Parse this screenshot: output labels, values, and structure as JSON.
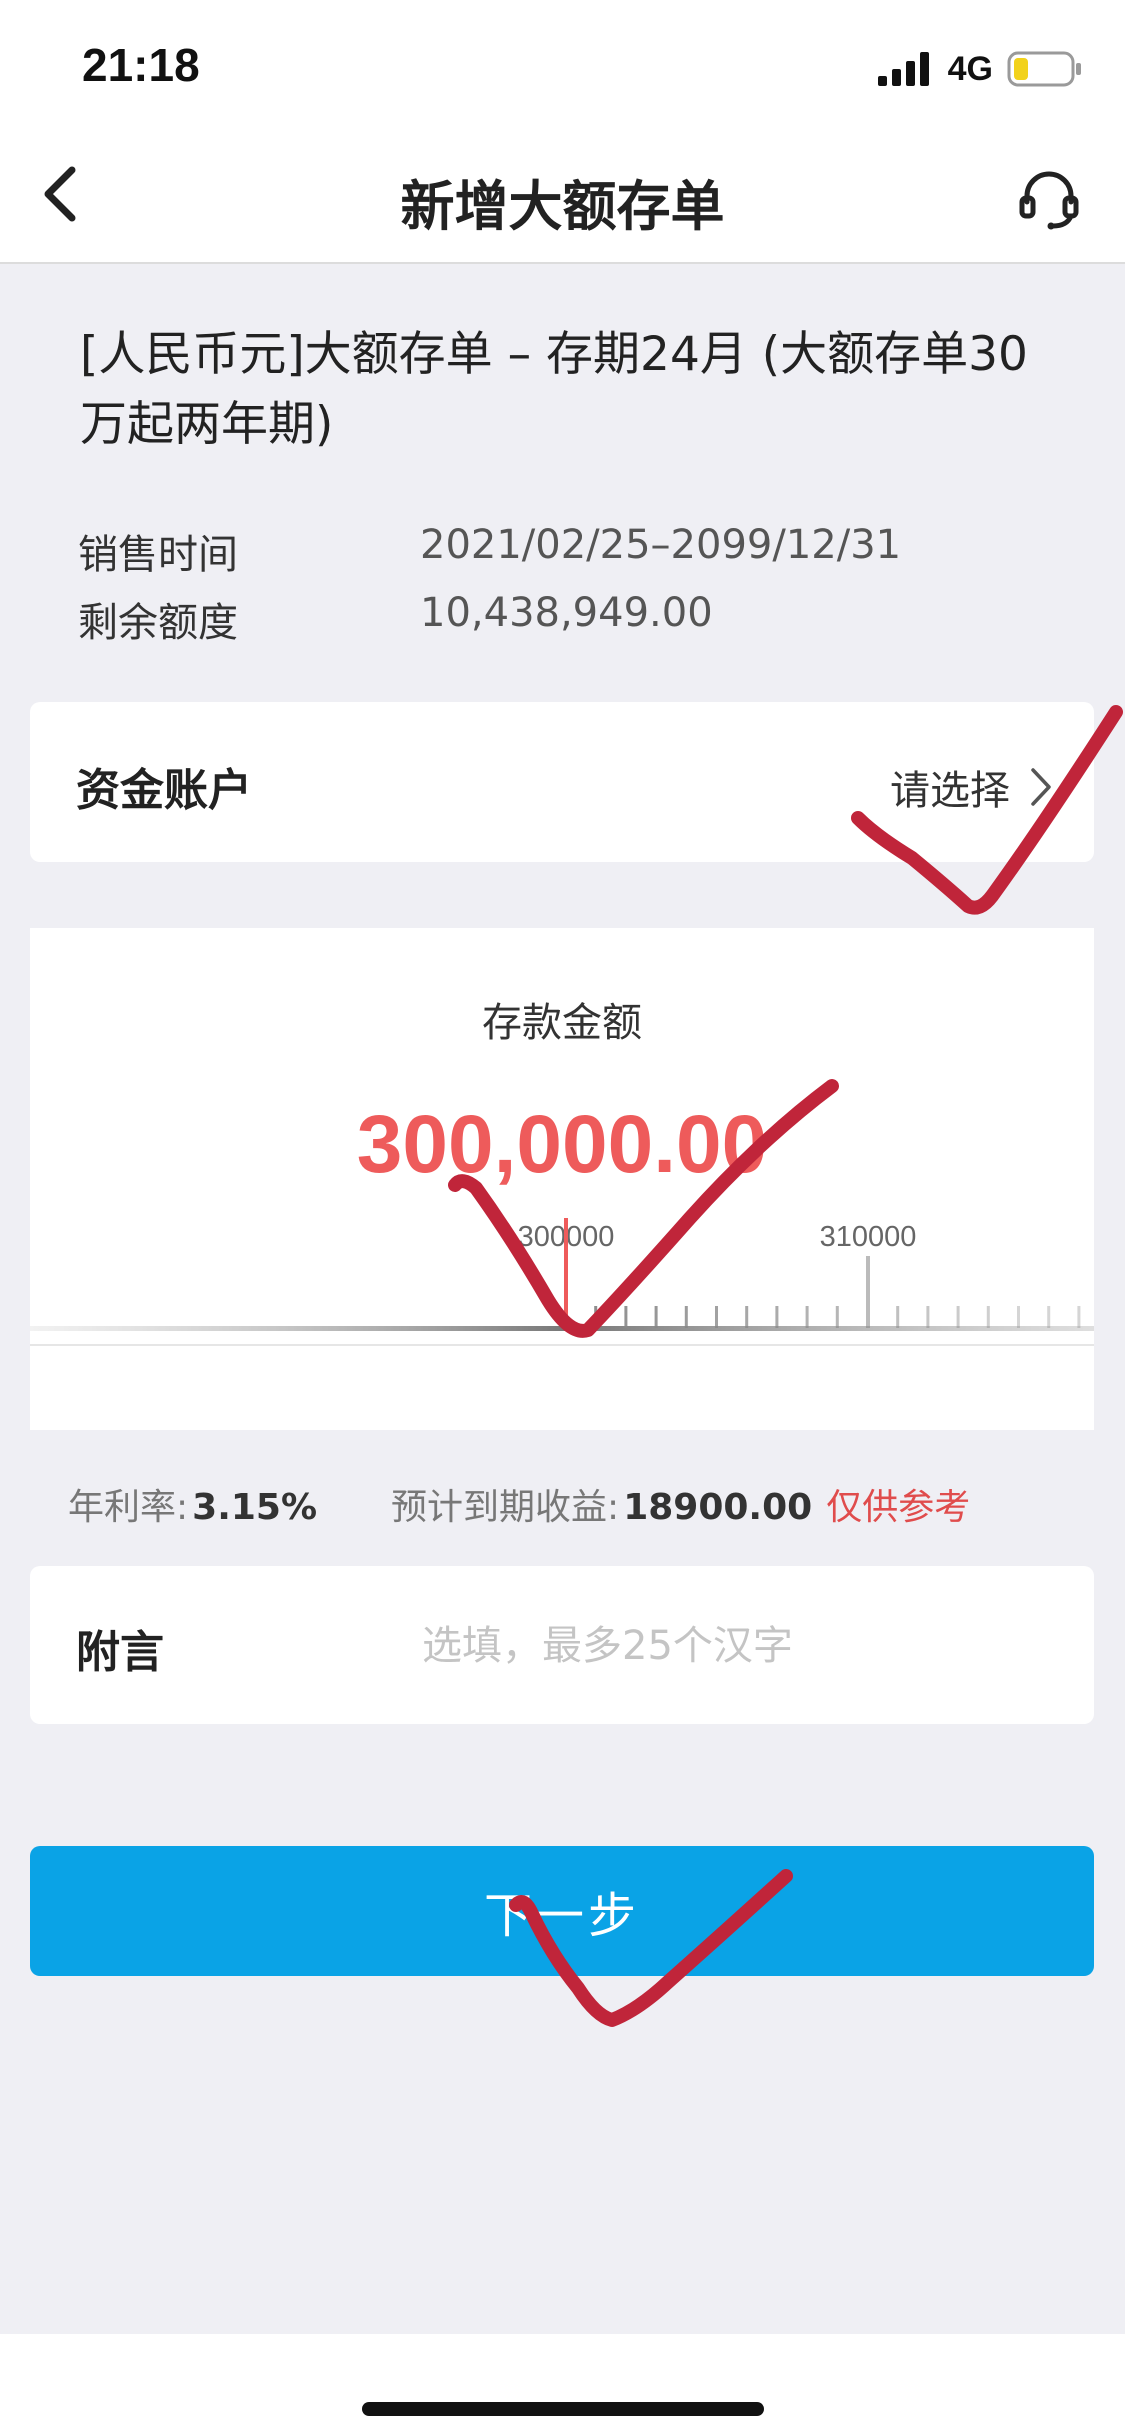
{
  "status_bar": {
    "time": "21:18",
    "network": "4G",
    "icons": [
      "signal-icon",
      "battery-icon"
    ]
  },
  "nav": {
    "title": "新增大额存单",
    "back_icon": "back-chevron-icon",
    "service_icon": "headset-icon"
  },
  "product": {
    "title": "[人民币元]大额存单 – 存期24月 (大额存单30万起两年期)",
    "sale_time_label": "销售时间",
    "sale_time_value": "2021/02/25–2099/12/31",
    "remaining_label": "剩余额度",
    "remaining_value": "10,438,949.00"
  },
  "account": {
    "label": "资金账户",
    "select_text": "请选择"
  },
  "amount": {
    "label": "存款金额",
    "value": "300,000.00",
    "ruler": {
      "labels": [
        "300000",
        "310000"
      ],
      "marks": [
        300000,
        310000
      ],
      "current": 300000
    }
  },
  "rate": {
    "label": "年利率:",
    "value": "3.15%",
    "income_label": "预计到期收益:",
    "income_value": "18900.00",
    "note": "仅供参考"
  },
  "note_field": {
    "label": "附言",
    "placeholder": "选填，最多25个汉字"
  },
  "next_button": {
    "label": "下一步"
  },
  "colors": {
    "accent": "#0aa3e6",
    "amount_red": "#ee5b5b",
    "reference_red": "#e04c4c",
    "background": "#efeff4",
    "checkmark": "#c0253a"
  }
}
